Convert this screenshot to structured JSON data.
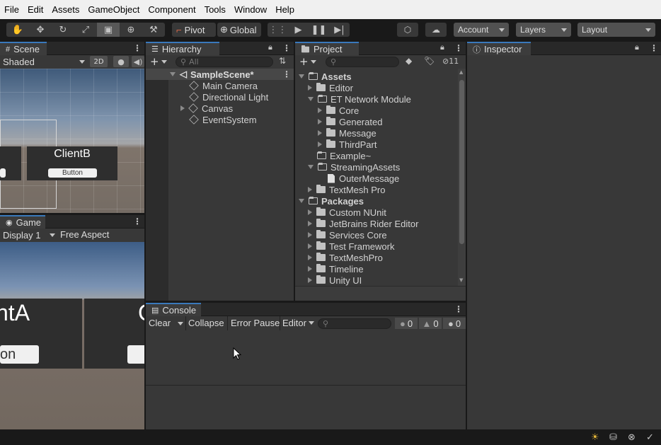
{
  "menu": [
    "File",
    "Edit",
    "Assets",
    "GameObject",
    "Component",
    "Tools",
    "Window",
    "Help"
  ],
  "toolbar": {
    "pivot": "Pivot",
    "global": "Global",
    "account": "Account",
    "layers": "Layers",
    "layout": "Layout"
  },
  "scene": {
    "tab": "Scene",
    "shading": "Shaded",
    "mode2d": "2D",
    "client_label": "ClientB",
    "button_label": "Button"
  },
  "game": {
    "tab": "Game",
    "display": "Display 1",
    "aspect": "Free Aspect",
    "client_partial": "ntA",
    "client_partial2": "C",
    "button_partial": "on"
  },
  "hierarchy": {
    "tab": "Hierarchy",
    "search_placeholder": "All",
    "scene": "SampleScene*",
    "items": [
      "Main Camera",
      "Directional Light",
      "Canvas",
      "EventSystem"
    ]
  },
  "project": {
    "tab": "Project",
    "hidden_count": "11",
    "assets": "Assets",
    "asset_items": [
      "Editor",
      "ET Network Module",
      "Core",
      "Generated",
      "Message",
      "ThirdPart",
      "Example~",
      "StreamingAssets",
      "OuterMessage",
      "TextMesh Pro"
    ],
    "packages": "Packages",
    "package_items": [
      "Custom NUnit",
      "JetBrains Rider Editor",
      "Services Core",
      "Test Framework",
      "TextMeshPro",
      "Timeline",
      "Unity UI"
    ]
  },
  "inspector": {
    "tab": "Inspector"
  },
  "console": {
    "tab": "Console",
    "clear": "Clear",
    "collapse": "Collapse",
    "error_pause": "Error Pause",
    "editor": "Editor",
    "log_count": "0",
    "warn_count": "0",
    "error_count": "0"
  },
  "colors": {
    "accent": "#3a79bb",
    "panel": "#383838",
    "menubar": "#f0f0f0"
  }
}
